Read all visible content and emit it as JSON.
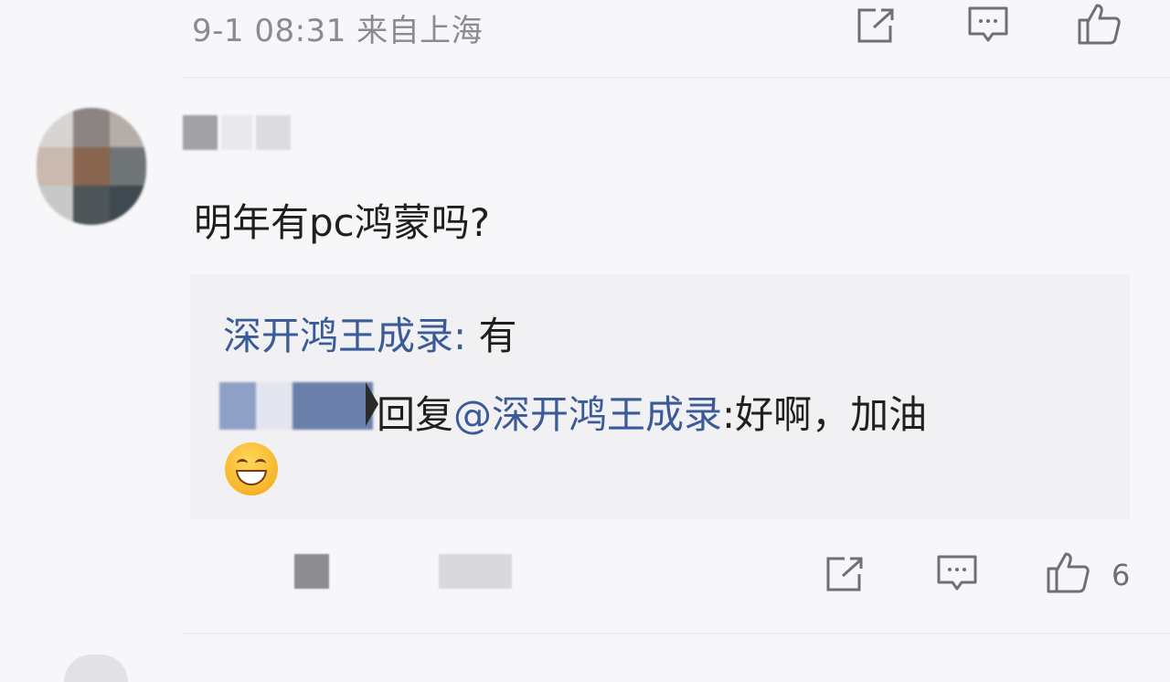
{
  "top_meta": {
    "time": "9-1 08:31",
    "location": "来自上海",
    "actions": {
      "share_icon": "share-icon",
      "comment_icon": "comment-icon",
      "like_icon": "thumbs-up-icon"
    }
  },
  "comment": {
    "text": "明年有pc鸿蒙吗?",
    "replies": [
      {
        "author": "深开鸿王成录",
        "separator": ": ",
        "text": "有"
      },
      {
        "verb": "回复",
        "mention": "@深开鸿王成录",
        "text": ":好啊，加油"
      }
    ],
    "emoji": "grinning-face-emoji"
  },
  "bottom_actions": {
    "like_count": "6",
    "share_icon": "share-icon",
    "comment_icon": "comment-icon",
    "like_icon": "thumbs-up-icon"
  },
  "colors": {
    "link": "#3b5a98",
    "text": "#1f1f1f",
    "meta": "#8a8a8f",
    "background": "#f7f7f9"
  }
}
